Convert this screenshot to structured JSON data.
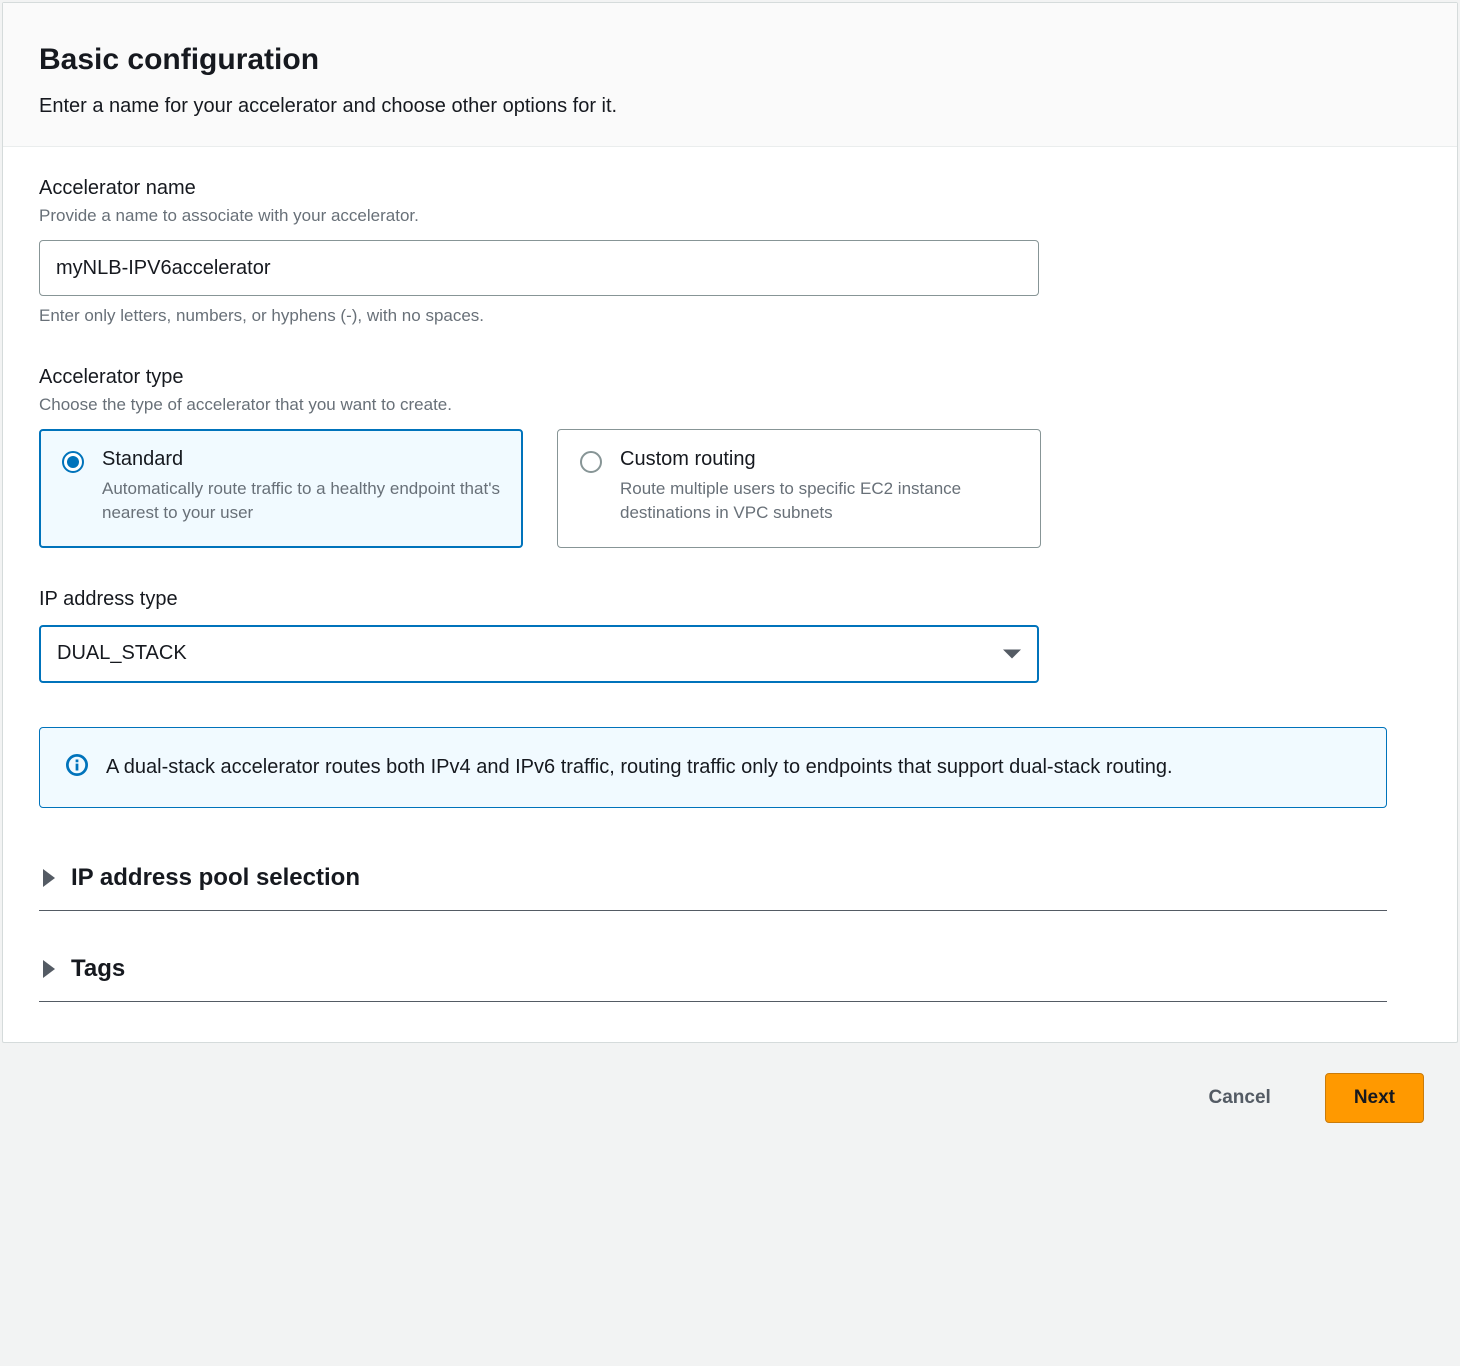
{
  "header": {
    "title": "Basic configuration",
    "subtitle": "Enter a name for your accelerator and choose other options for it."
  },
  "name_field": {
    "label": "Accelerator name",
    "hint": "Provide a name to associate with your accelerator.",
    "value": "myNLB-IPV6accelerator",
    "subhint": "Enter only letters, numbers, or hyphens (-), with no spaces."
  },
  "type_field": {
    "label": "Accelerator type",
    "hint": "Choose the type of accelerator that you want to create.",
    "options": [
      {
        "title": "Standard",
        "desc": "Automatically route traffic to a healthy endpoint that's nearest to your user",
        "selected": true
      },
      {
        "title": "Custom routing",
        "desc": "Route multiple users to specific EC2 instance destinations in VPC subnets",
        "selected": false
      }
    ]
  },
  "ip_type_field": {
    "label": "IP address type",
    "value": "DUAL_STACK"
  },
  "info_box": {
    "text": "A dual-stack accelerator routes both IPv4 and IPv6 traffic, routing traffic only to endpoints that support dual-stack routing."
  },
  "expandables": [
    {
      "label": "IP address pool selection"
    },
    {
      "label": "Tags"
    }
  ],
  "footer": {
    "cancel": "Cancel",
    "next": "Next"
  }
}
